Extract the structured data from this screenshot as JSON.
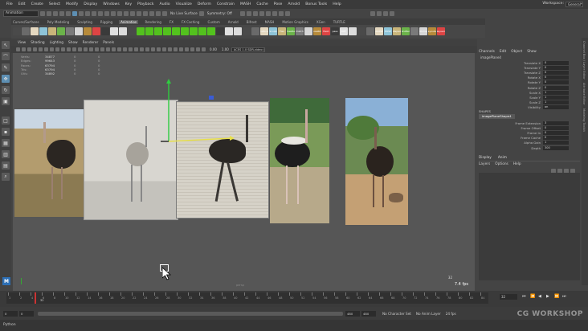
{
  "menubar": {
    "items": [
      "File",
      "Edit",
      "Create",
      "Select",
      "Modify",
      "Display",
      "Windows",
      "Key",
      "Playback",
      "Audio",
      "Visualize",
      "Deform",
      "Constrain",
      "MASH",
      "Cache",
      "Pose",
      "Arnold",
      "Bonus Tools",
      "Help"
    ],
    "workspace_label": "Workspace:",
    "workspace_value": "General*"
  },
  "statusline": {
    "mode": "Animation",
    "live_surface": "No Live Surface",
    "symmetry": "Symmetry: Off"
  },
  "shelf": {
    "tabs": [
      "Curves/Surfaces",
      "Poly Modeling",
      "Sculpting",
      "Rigging",
      "Animation",
      "Rendering",
      "FX",
      "FX Caching",
      "Custom",
      "Arnold",
      "Bifrost",
      "MASH",
      "Motion Graphics",
      "XGen",
      "TURTLE"
    ],
    "active_tab": "Animation",
    "icon_labels": [
      "",
      "",
      "",
      "",
      "",
      "",
      "",
      "",
      "",
      "",
      "",
      "",
      "",
      "",
      "",
      "",
      "",
      "",
      "",
      "",
      "",
      "",
      "",
      "",
      "",
      "",
      "",
      "",
      "lattice",
      "Sculpt",
      "Flex",
      "PoseDef",
      "match",
      "",
      "poseRmr",
      "flash",
      "pass",
      "DEF",
      "",
      "",
      "",
      "AddSP",
      "POSE",
      "cut&paste",
      "stutter",
      "",
      "DDsmap",
      "layouter",
      "layuerr"
    ]
  },
  "viewport": {
    "menu": [
      "View",
      "Shading",
      "Lighting",
      "Show",
      "Renderer",
      "Panels"
    ],
    "value1": "0.00",
    "value2": "1.00",
    "colorspace": "ACES 1.0 SDR-video (sRGB)",
    "hud": [
      {
        "label": "Verts:",
        "v1": "34877",
        "v2": "0",
        "v3": "0"
      },
      {
        "label": "Edges:",
        "v1": "99643",
        "v2": "0",
        "v3": "0"
      },
      {
        "label": "Faces:",
        "v1": "63794",
        "v2": "0",
        "v3": "0"
      },
      {
        "label": "Tris:",
        "v1": "63794",
        "v2": "0",
        "v3": "0"
      },
      {
        "label": "UVs:",
        "v1": "34892",
        "v2": "0",
        "v3": "0"
      }
    ],
    "camera": "persp",
    "current_frame_hud": "32",
    "fps": "7.4 fps",
    "logo": "M"
  },
  "channel_box": {
    "tabs": [
      "Channels",
      "Edit",
      "Object",
      "Show"
    ],
    "node": "imagePlane4",
    "attributes": [
      {
        "name": "Translate X",
        "value": "0"
      },
      {
        "name": "Translate Y",
        "value": "0"
      },
      {
        "name": "Translate Z",
        "value": "0"
      },
      {
        "name": "Rotate X",
        "value": "0"
      },
      {
        "name": "Rotate Y",
        "value": "0"
      },
      {
        "name": "Rotate Z",
        "value": "0"
      },
      {
        "name": "Scale X",
        "value": "1"
      },
      {
        "name": "Scale Y",
        "value": "1"
      },
      {
        "name": "Scale Z",
        "value": "1"
      },
      {
        "name": "Visibility",
        "value": "on"
      }
    ],
    "shapes_header": "SHAPES",
    "shape_node": "imagePlaneShape4",
    "shape_attributes": [
      {
        "name": "Frame Extension",
        "value": "3"
      },
      {
        "name": "Frame Offset",
        "value": "0"
      },
      {
        "name": "Frame In",
        "value": "0"
      },
      {
        "name": "Frame Cache",
        "value": "0"
      },
      {
        "name": "Alpha Gain",
        "value": "1"
      },
      {
        "name": "Depth",
        "value": "300"
      }
    ]
  },
  "layer_editor": {
    "tabs": [
      "Display",
      "Anim"
    ],
    "menu": [
      "Layers",
      "Options",
      "Help"
    ]
  },
  "side_tabs": [
    "Channel Box / Layer Editor",
    "Attribute Editor",
    "Modeling Toolkit"
  ],
  "timeline": {
    "ticks": [
      "1",
      "2",
      "4",
      "6",
      "8",
      "10",
      "12",
      "14",
      "16",
      "18",
      "20",
      "22",
      "24",
      "26",
      "28",
      "30",
      "32",
      "34",
      "36",
      "38",
      "40",
      "42",
      "44",
      "46",
      "48",
      "50",
      "52",
      "54",
      "56",
      "58",
      "60",
      "62",
      "64",
      "66",
      "68",
      "70",
      "72",
      "74",
      "76",
      "78",
      "80",
      "82",
      "84"
    ],
    "current_frame": "32",
    "playhead_label": "32"
  },
  "range": {
    "start": "0",
    "inner_start": "0",
    "inner_end": "480",
    "end": "480",
    "character_set": "No Character Set",
    "anim_layer": "No Anim Layer",
    "fps": "24 fps"
  },
  "command_line": {
    "label": "Python"
  },
  "watermark": "CG WORKSHOP"
}
